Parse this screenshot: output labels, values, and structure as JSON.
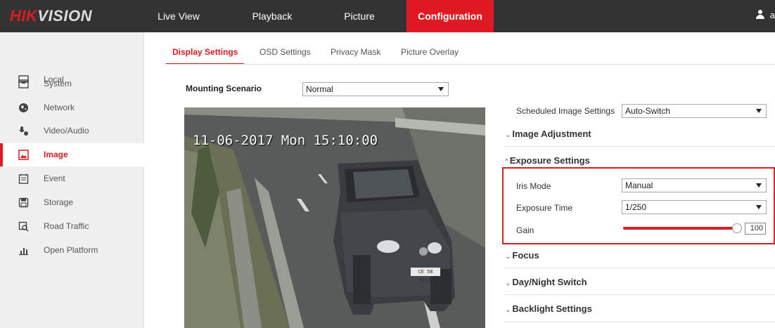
{
  "header": {
    "logo_hik": "HIK",
    "logo_vision": "VISION",
    "nav": [
      "Live View",
      "Playback",
      "Picture",
      "Configuration"
    ],
    "active_nav": "Configuration",
    "user_initial": "a"
  },
  "sidebar": {
    "items": [
      {
        "label": "Local",
        "icon": "monitor-icon"
      },
      {
        "label": "System",
        "icon": "system-icon"
      },
      {
        "label": "Network",
        "icon": "network-icon"
      },
      {
        "label": "Video/Audio",
        "icon": "video-audio-icon"
      },
      {
        "label": "Image",
        "icon": "image-icon",
        "active": true
      },
      {
        "label": "Event",
        "icon": "event-icon"
      },
      {
        "label": "Storage",
        "icon": "storage-icon"
      },
      {
        "label": "Road Traffic",
        "icon": "road-traffic-icon"
      },
      {
        "label": "Open Platform",
        "icon": "open-platform-icon"
      }
    ]
  },
  "tabs": [
    "Display Settings",
    "OSD Settings",
    "Privacy Mask",
    "Picture Overlay"
  ],
  "active_tab": "Display Settings",
  "mounting": {
    "label": "Mounting Scenario",
    "value": "Normal"
  },
  "video": {
    "osd_text": "11-06-2017 Mon 15:10:00",
    "plate_text": "CE 58 RHGP"
  },
  "settings": {
    "scheduled_label": "Scheduled Image Settings",
    "scheduled_value": "Auto-Switch",
    "sections": {
      "image_adjustment": "Image Adjustment",
      "exposure": "Exposure Settings",
      "focus": "Focus",
      "day_night": "Day/Night Switch",
      "backlight": "Backlight Settings"
    },
    "iris_label": "Iris Mode",
    "iris_value": "Manual",
    "exposure_time_label": "Exposure Time",
    "exposure_time_value": "1/250",
    "gain_label": "Gain",
    "gain_value": "100",
    "gain_fraction": 1.0
  },
  "colors": {
    "accent": "#e01a22",
    "topbar": "#333333",
    "highlight_box": "#d42027"
  }
}
